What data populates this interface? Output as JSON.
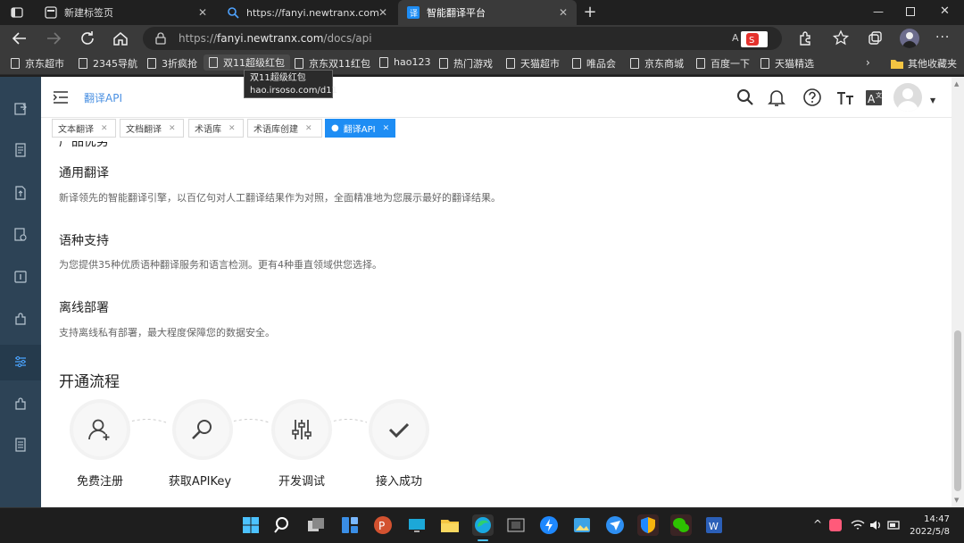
{
  "tabs": [
    {
      "title": "新建标签页",
      "active": false
    },
    {
      "title": "https://fanyi.newtranx.com - 搜索",
      "active": false
    },
    {
      "title": "智能翻译平台",
      "active": true
    }
  ],
  "address": {
    "scheme": "https://",
    "host": "fanyi.newtranx.com",
    "path": "/docs/api"
  },
  "bookmarks": [
    "京东超市",
    "2345导航",
    "3折疯抢",
    "双11超级红包",
    "京东双11红包",
    "hao123",
    "热门游戏",
    "天猫超市",
    "唯品会",
    "京东商城",
    "百度一下",
    "天猫精选"
  ],
  "other_bookmarks": "其他收藏夹",
  "tooltip": {
    "title": "双11超级红包",
    "url": "hao.irsoso.com/d11"
  },
  "app": {
    "breadcrumb": "翻译API",
    "page_tabs": [
      {
        "label": "文本翻译",
        "active": false
      },
      {
        "label": "文档翻译",
        "active": false
      },
      {
        "label": "术语库",
        "active": false
      },
      {
        "label": "术语库创建",
        "active": false
      },
      {
        "label": "翻译API",
        "active": true
      }
    ],
    "section_partial": "产品优势",
    "features": [
      {
        "title": "通用翻译",
        "desc": "新译领先的智能翻译引擎，以百亿句对人工翻译结果作为对照，全面精准地为您展示最好的翻译结果。"
      },
      {
        "title": "语种支持",
        "desc": "为您提供35种优质语种翻译服务和语言检测。更有4种垂直领域供您选择。"
      },
      {
        "title": "离线部署",
        "desc": "支持离线私有部署，最大程度保障您的数据安全。"
      }
    ],
    "process_title": "开通流程",
    "steps": [
      {
        "label": "免费注册",
        "icon": "user-add-icon"
      },
      {
        "label": "获取APIKey",
        "icon": "key-search-icon"
      },
      {
        "label": "开发调试",
        "icon": "sliders-icon"
      },
      {
        "label": "接入成功",
        "icon": "check-icon"
      }
    ]
  },
  "taskbar": {
    "time": "14:47",
    "date": "2022/5/8"
  },
  "colors": {
    "accent": "#1e8df4",
    "sidebar": "#2d4356",
    "chrome": "#202020"
  }
}
